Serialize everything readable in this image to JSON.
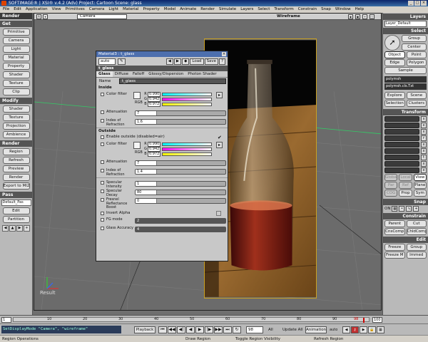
{
  "title": "SOFTIMAGE® | XSI® v.4.2 (Adv) Project: Cartoon   Scene: glass",
  "menu": [
    "File",
    "Edit",
    "Application",
    "View",
    "Primitives",
    "Camera",
    "Light",
    "Material",
    "Property",
    "Model",
    "Animate",
    "Render",
    "Simulate",
    "Layers",
    "Select",
    "Transform",
    "Constrain",
    "Snap",
    "Window",
    "Help"
  ],
  "left": {
    "header": "Render",
    "get": {
      "label": "Get",
      "items": [
        "Primitive",
        "Camera",
        "Light",
        "Material",
        "Property",
        "Shader",
        "Texture",
        "Clip"
      ]
    },
    "modify": {
      "label": "Modify",
      "items": [
        "Shader",
        "Texture",
        "Projection",
        "Ambience"
      ]
    },
    "render": {
      "label": "Render",
      "items": [
        "Region",
        "Refresh",
        "Preview",
        "Render",
        "Export to MI2"
      ]
    },
    "pass": {
      "label": "Pass",
      "dropdown": "Default_Pas",
      "items": [
        "Edit",
        "Partition"
      ]
    }
  },
  "viewport": {
    "camera": "Camera",
    "mode": "Wireframe",
    "result_label": "Result"
  },
  "material": {
    "title": "Material3 : t_glass",
    "auto": "auto",
    "load": "Load",
    "save": "Save",
    "shader_name": "t_glass",
    "tabs": [
      "Glass",
      "Diffuse",
      "Falloff",
      "Glossy/Dispersion",
      "Photon Shader"
    ],
    "name_label": "Name",
    "name_value": "t_glass",
    "inside_label": "Inside",
    "color_filter_label": "Color filter",
    "inside_color": {
      "rgb_label": "RGB",
      "r_label": "R",
      "g_label": "G",
      "b_label": "B",
      "r": "0.990",
      "g": "0.942",
      "b": "0.972"
    },
    "attenuation_label": "Attenuation",
    "inside_attenuation": "7",
    "ior_label": "Index of Refraction",
    "inside_ior": "1.6",
    "outside_label": "Outside",
    "enable_outside_label": "Enable outside (disabled=air)",
    "outside_color": {
      "rgb_label": "RGB",
      "r_label": "R",
      "g_label": "G",
      "b_label": "B",
      "r": "0.990",
      "g": "0.942",
      "b": "0.972"
    },
    "outside_attenuation": "7",
    "outside_ior": "1.4",
    "specular_intensity_label": "Specular Intensity",
    "specular_intensity": "1",
    "specular_decay_label": "Specular Decay",
    "specular_decay": "80",
    "fresnel_label": "Fresnel Reflectance Boost",
    "fresnel": "0",
    "invert_alpha_label": "Invert Alpha",
    "fg_mode_label": "FG mode",
    "fg_mode": "2",
    "glass_accuracy_label": "Glass Accuracy",
    "glass_accuracy": "4"
  },
  "right": {
    "layers": {
      "label": "Layers",
      "dropdown": "Layer_Default"
    },
    "select": {
      "label": "Select",
      "group": "Group",
      "center": "Center",
      "object": "Object",
      "point": "Point",
      "edge": "Edge",
      "polygon": "Polygon",
      "sample": "Sample"
    },
    "objects": [
      "polymsh",
      "polymsh.cls.Txt"
    ],
    "explore": "Explore",
    "scene": "Scene",
    "selection": "Selection",
    "clusters": "Clusters",
    "transform": {
      "label": "Transform",
      "rows": [
        "s",
        "r",
        "t"
      ],
      "global": "Global",
      "local": "Local",
      "view": "View",
      "par": "Par",
      "ref": "Ref",
      "plane": "Plane",
      "cog": "COG",
      "prop": "Prop",
      "sym": "Sym"
    },
    "snap": {
      "label": "Snap",
      "on": "ON"
    },
    "constrain": {
      "label": "Constrain",
      "parent": "Parent",
      "cut": "Cut",
      "cnscomp": "CnsComp",
      "chldcomp": "ChldComp"
    },
    "edit": {
      "label": "Edit",
      "freeze": "Freeze",
      "group": "Group",
      "freezem": "Freeze M",
      "immed": "Immed"
    }
  },
  "timeline": {
    "start": "1",
    "end": "100",
    "marks": [
      "10",
      "20",
      "30",
      "40",
      "50",
      "60",
      "70",
      "80",
      "90"
    ],
    "current": "98"
  },
  "status": {
    "command": "SetDisplayMode \"Camera\", \"wireframe\"",
    "playback": "Playback",
    "frame": "98",
    "all": "All",
    "update": "Update All",
    "animation": "Animation",
    "auto": "auto"
  },
  "hints": [
    "Region Operations",
    "Draw Region",
    "Toggle Region Visibility",
    "Refresh Region"
  ]
}
